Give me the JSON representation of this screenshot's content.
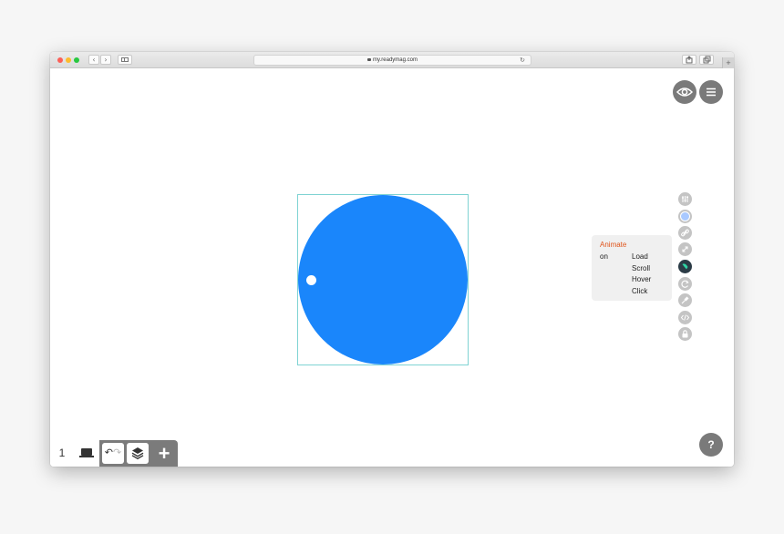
{
  "browser": {
    "address": "my.readymag.com",
    "back_glyph": "‹",
    "forward_glyph": "›",
    "reload_glyph": "↻",
    "newtab_glyph": "+"
  },
  "editor": {
    "help_label": "?",
    "page_number": "1",
    "undo_glyph": "↶",
    "redo_glyph": "↷",
    "add_glyph": "+",
    "accent_color": "#1a86fb",
    "widget_shape": "circle"
  },
  "animation_panel": {
    "title": "Animate",
    "on_label": "on",
    "triggers": [
      "Load",
      "Scroll",
      "Hover",
      "Click"
    ]
  },
  "toolbar": {
    "tools": [
      {
        "name": "sliders-icon"
      },
      {
        "name": "fill-color-icon"
      },
      {
        "name": "link-icon"
      },
      {
        "name": "scale-icon"
      },
      {
        "name": "animation-icon",
        "active": true
      },
      {
        "name": "rotate-icon"
      },
      {
        "name": "pin-icon"
      },
      {
        "name": "code-icon"
      },
      {
        "name": "lock-icon"
      }
    ]
  }
}
